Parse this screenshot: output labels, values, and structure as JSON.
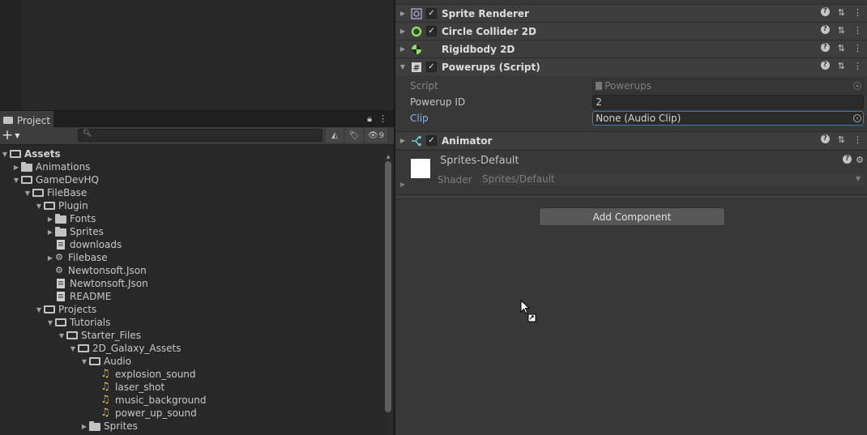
{
  "project": {
    "tab_label": "Project",
    "hidden_count": "9",
    "search_placeholder": "",
    "tree": [
      {
        "label": "Assets",
        "depth": 0,
        "arrow": "▼",
        "icon": "folder-open",
        "bold": true
      },
      {
        "label": "Animations",
        "depth": 1,
        "arrow": "▶",
        "icon": "folder"
      },
      {
        "label": "GameDevHQ",
        "depth": 1,
        "arrow": "▼",
        "icon": "folder-open"
      },
      {
        "label": "FileBase",
        "depth": 2,
        "arrow": "▼",
        "icon": "folder-open"
      },
      {
        "label": "Plugin",
        "depth": 3,
        "arrow": "▼",
        "icon": "folder-open"
      },
      {
        "label": "Fonts",
        "depth": 4,
        "arrow": "▶",
        "icon": "folder"
      },
      {
        "label": "Sprites",
        "depth": 4,
        "arrow": "▶",
        "icon": "folder"
      },
      {
        "label": "downloads",
        "depth": 4,
        "arrow": "",
        "icon": "file"
      },
      {
        "label": "Filebase",
        "depth": 4,
        "arrow": "▶",
        "icon": "plugin"
      },
      {
        "label": "Newtonsoft.Json",
        "depth": 4,
        "arrow": "",
        "icon": "plugin"
      },
      {
        "label": "Newtonsoft.Json",
        "depth": 4,
        "arrow": "",
        "icon": "file"
      },
      {
        "label": "README",
        "depth": 4,
        "arrow": "",
        "icon": "file"
      },
      {
        "label": "Projects",
        "depth": 3,
        "arrow": "▼",
        "icon": "folder-open"
      },
      {
        "label": "Tutorials",
        "depth": 4,
        "arrow": "▼",
        "icon": "folder-open"
      },
      {
        "label": "Starter_Files",
        "depth": 5,
        "arrow": "▼",
        "icon": "folder-open"
      },
      {
        "label": "2D_Galaxy_Assets",
        "depth": 6,
        "arrow": "▼",
        "icon": "folder-open"
      },
      {
        "label": "Audio",
        "depth": 7,
        "arrow": "▼",
        "icon": "folder-open"
      },
      {
        "label": "explosion_sound",
        "depth": 8,
        "arrow": "",
        "icon": "audio"
      },
      {
        "label": "laser_shot",
        "depth": 8,
        "arrow": "",
        "icon": "audio"
      },
      {
        "label": "music_background",
        "depth": 8,
        "arrow": "",
        "icon": "audio"
      },
      {
        "label": "power_up_sound",
        "depth": 8,
        "arrow": "",
        "icon": "audio"
      },
      {
        "label": "Sprites",
        "depth": 7,
        "arrow": "▶",
        "icon": "folder"
      }
    ]
  },
  "inspector": {
    "components": [
      {
        "title": "Sprite Renderer",
        "checkbox": true,
        "icon": "sprite-renderer-icon",
        "arrow": "▶"
      },
      {
        "title": "Circle Collider 2D",
        "checkbox": true,
        "icon": "circle-collider-icon",
        "arrow": "▶"
      },
      {
        "title": "Rigidbody 2D",
        "checkbox": false,
        "icon": "rigidbody-icon",
        "arrow": "▶"
      },
      {
        "title": "Powerups (Script)",
        "checkbox": true,
        "icon": "script-icon",
        "arrow": "▼"
      },
      {
        "title": "Animator",
        "checkbox": true,
        "icon": "animator-icon",
        "arrow": "▶"
      }
    ],
    "script_props": {
      "script_label": "Script",
      "script_value": "Powerups",
      "powerup_id_label": "Powerup ID",
      "powerup_id_value": "2",
      "clip_label": "Clip",
      "clip_value": "None (Audio Clip)"
    },
    "material": {
      "name": "Sprites-Default",
      "shader_label": "Shader",
      "shader_value": "Sprites/Default"
    },
    "add_component_label": "Add Component"
  },
  "colors": {
    "accent_blue": "#7eb6f2",
    "audio_icon": "#e9b93a",
    "circle_collider": "#8ee25a"
  }
}
